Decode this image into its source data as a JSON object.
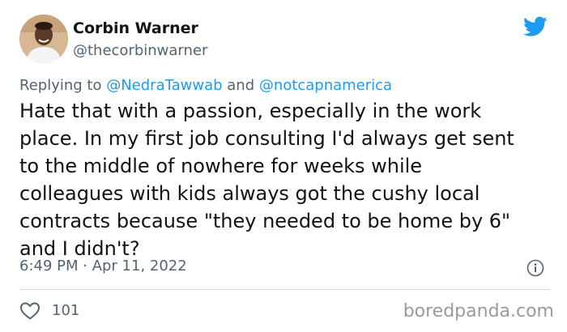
{
  "tweet": {
    "author_name": "Corbin Warner",
    "author_handle": "@thecorbinwarner",
    "reply_prefix": "Replying to ",
    "reply_user_1": "@NedraTawwab",
    "reply_and": " and ",
    "reply_user_2": "@notcapnamerica",
    "text_lines": [
      "Hate that with a passion, especially in the work",
      "place. In my first job consulting I'd always get sent",
      "to the middle of nowhere for weeks while",
      "colleagues with kids always got the cushy local",
      "contracts because \"they needed to be home by 6\"",
      "and I didn't?"
    ],
    "timestamp": "6:49 PM · Apr 11, 2022",
    "like_count": "101"
  },
  "watermark": "boredpanda.com",
  "colors": {
    "accent": "#1d9bf0",
    "text": "#0f1419",
    "muted": "#536471"
  },
  "icons": {
    "brand": "twitter-bird-icon",
    "info": "info-icon",
    "like": "heart-icon"
  }
}
